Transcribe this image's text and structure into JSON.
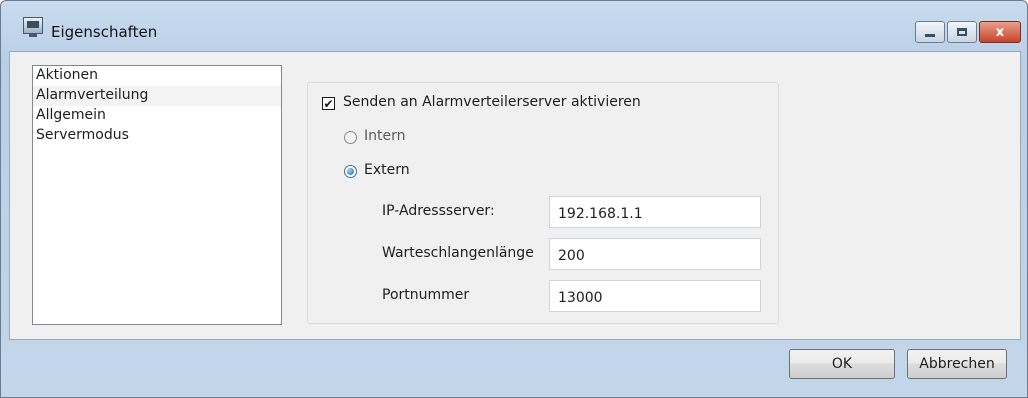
{
  "window": {
    "title": "Eigenschaften",
    "minimize_icon": "minimize-icon",
    "maximize_icon": "maximize-icon",
    "close_label": "x"
  },
  "sidebar": {
    "items": [
      {
        "label": "Aktionen"
      },
      {
        "label": "Alarmverteilung",
        "selected": true
      },
      {
        "label": "Allgemein"
      },
      {
        "label": "Servermodus"
      }
    ]
  },
  "settings": {
    "enable_checkbox": {
      "label": "Senden an Alarmverteilerserver aktivieren",
      "checked": true
    },
    "mode_options": [
      {
        "label": "Intern",
        "selected": false,
        "enabled": false
      },
      {
        "label": "Extern",
        "selected": true,
        "enabled": true
      }
    ],
    "fields": [
      {
        "label": "IP-Adressserver:",
        "value": "192.168.1.1"
      },
      {
        "label": "Warteschlangenlänge",
        "value": "200"
      },
      {
        "label": "Portnummer",
        "value": "13000"
      }
    ]
  },
  "footer": {
    "ok_label": "OK",
    "cancel_label": "Abbrechen"
  }
}
